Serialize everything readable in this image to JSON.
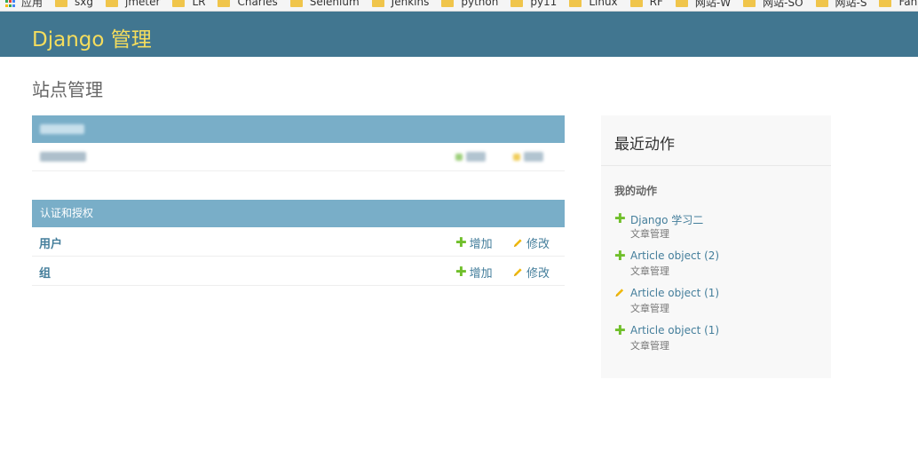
{
  "bookmarks": {
    "apps_label": "应用",
    "items": [
      "sxg",
      "jmeter",
      "LR",
      "Charles",
      "Selenium",
      "Jenkins",
      "python",
      "py11",
      "Linux",
      "RF",
      "网站-W",
      "网站-SO",
      "网站-S",
      "Fanta"
    ]
  },
  "header": {
    "branding": "Django 管理"
  },
  "page": {
    "title": "站点管理"
  },
  "module_auth": {
    "caption": "认证和授权",
    "rows": [
      {
        "name": "用户",
        "add": "增加",
        "change": "修改"
      },
      {
        "name": "组",
        "add": "增加",
        "change": "修改"
      }
    ]
  },
  "recent": {
    "title": "最近动作",
    "my_actions": "我的动作",
    "actions": [
      {
        "type": "add",
        "link": "Django 学习二",
        "sub": "文章管理"
      },
      {
        "type": "add",
        "link": "Article object (2)",
        "sub": "文章管理"
      },
      {
        "type": "change",
        "link": "Article object (1)",
        "sub": "文章管理"
      },
      {
        "type": "add",
        "link": "Article object (1)",
        "sub": "文章管理"
      }
    ]
  },
  "colors": {
    "header": "#417690",
    "branding": "#f5dd5d",
    "caption": "#79aec8",
    "link": "#447e9b",
    "add_icon": "#70bf2b",
    "change_icon": "#efb80b"
  }
}
